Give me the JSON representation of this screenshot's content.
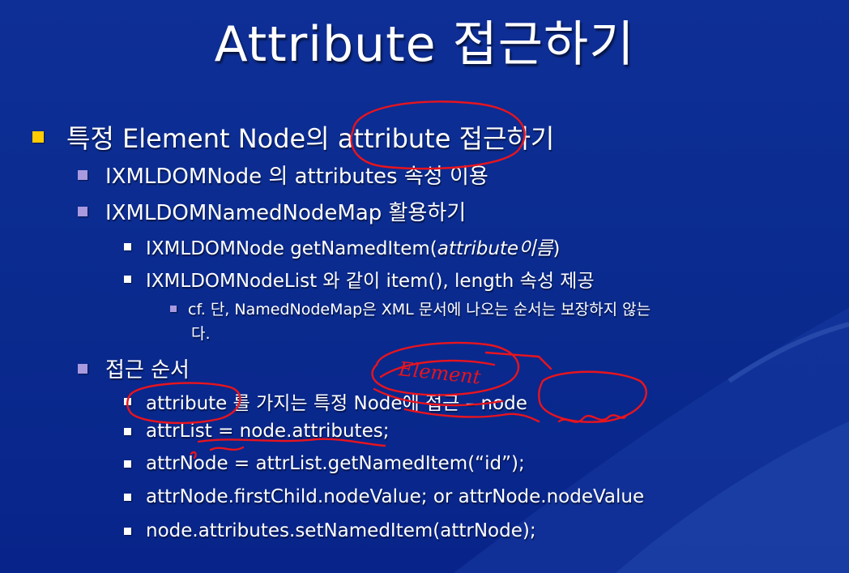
{
  "slide": {
    "title": "Attribute 접근하기",
    "items": [
      {
        "level": 1,
        "text": "특정 Element Node의 attribute 접근하기"
      },
      {
        "level": 2,
        "text": "IXMLDOMNode 의 attributes 속성 이용"
      },
      {
        "level": 2,
        "text": "IXMLDOMNamedNodeMap 활용하기"
      },
      {
        "level": 3,
        "prefix": "IXMLDOMNode getNamedItem(",
        "italic": "attribute이름",
        "suffix": ")"
      },
      {
        "level": 3,
        "text": "IXMLDOMNodeList 와 같이 item(), length 속성 제공"
      },
      {
        "level": 4,
        "text": "cf. 단, NamedNodeMap은 XML 문서에 나오는 순서는 보장하지 않는",
        "cont": "다."
      },
      {
        "level": 2,
        "text": "접근 순서"
      },
      {
        "level": 3,
        "text": "attribute 를 가지는 특정 Node에 접근 – node"
      },
      {
        "level": 3,
        "text": "attrList = node.attributes;"
      },
      {
        "level": 3,
        "text": "attrNode = attrList.getNamedItem(“id”);"
      },
      {
        "level": 3,
        "text": "attrNode.firstChild.nodeValue; or attrNode.nodeValue"
      },
      {
        "level": 3,
        "text": "node.attributes.setNamedItem(attrNode);"
      }
    ],
    "annotation_text": "Element"
  },
  "colors": {
    "background": "#0a2a8e",
    "bullet_level1": "#ffcc00",
    "bullet_level2": "#a99ae0",
    "bullet_level3": "#ffffff",
    "ink": "#e8141e"
  }
}
